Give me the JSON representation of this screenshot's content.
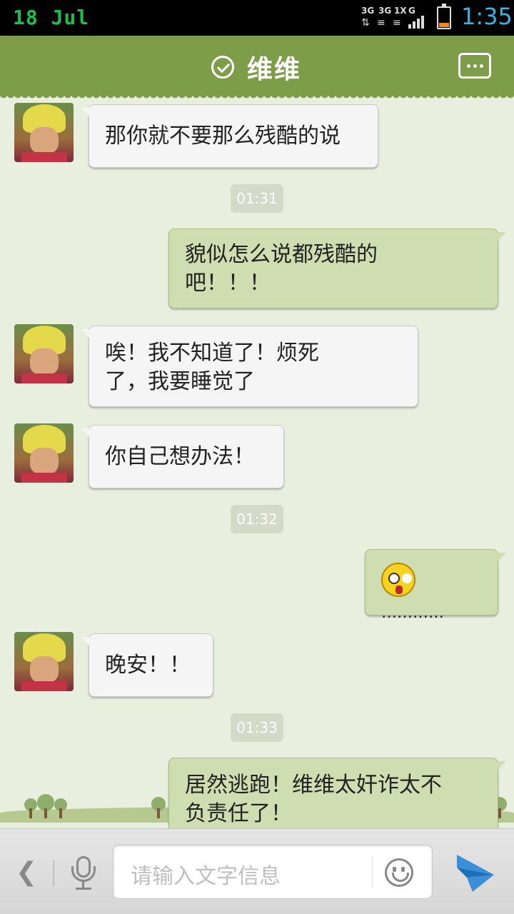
{
  "status_bar": {
    "date": "18 Jul",
    "network_labels": [
      "3G",
      "3G",
      "1X",
      "G"
    ],
    "time": "1:35",
    "battery_level": 0.2
  },
  "header": {
    "title": "维维",
    "verified_icon": "check-circle-icon",
    "more_icon": "more-dots-icon"
  },
  "messages": [
    {
      "side": "in",
      "text": "那你就不要那么残酷的说"
    },
    {
      "type": "time",
      "text": "01:31"
    },
    {
      "side": "out",
      "text_lines": [
        "貌似怎么说都残酷的",
        "吧！！！"
      ]
    },
    {
      "side": "in",
      "text_lines": [
        "唉！我不知道了！烦死",
        "了，我要睡觉了"
      ]
    },
    {
      "side": "in",
      "text": "你自己想办法！"
    },
    {
      "type": "time",
      "text": "01:32"
    },
    {
      "side": "out",
      "emoji": "shocked-face-icon",
      "text": "…………"
    },
    {
      "side": "in",
      "text": "晚安！！"
    },
    {
      "type": "time",
      "text": "01:33"
    },
    {
      "side": "out",
      "text_lines": [
        "居然逃跑！维维太奸诈太不",
        "负责任了！"
      ]
    }
  ],
  "input_bar": {
    "placeholder": "请输入文字信息",
    "back_symbol": "❮",
    "icons": [
      "back-arrow-icon",
      "mic-icon",
      "smiley-icon",
      "send-icon"
    ]
  },
  "colors": {
    "header": "#7d9d49",
    "background": "#e8efdf",
    "incoming_bubble": "#f5f5f5",
    "outgoing_bubble": "#cfdeb0",
    "time_text": "#33b5e5",
    "date_text": "#19c24a"
  }
}
